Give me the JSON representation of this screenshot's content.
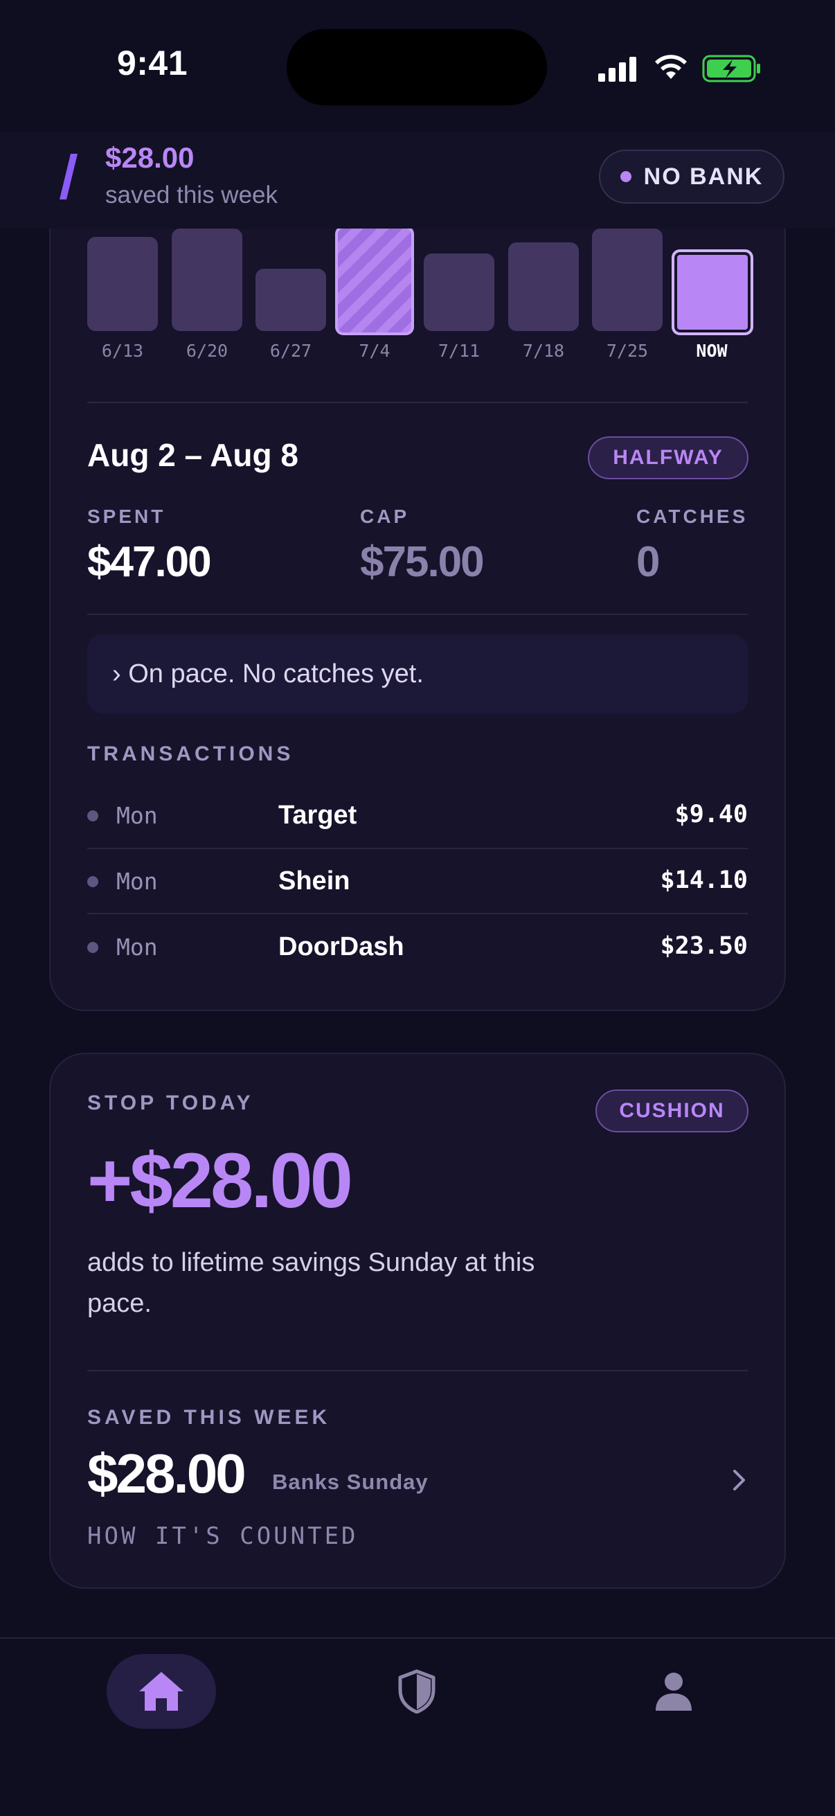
{
  "status": {
    "time": "9:41"
  },
  "header": {
    "amount": "$28.00",
    "subtitle": "saved this week",
    "bank_status": "NO BANK"
  },
  "chart": {
    "categories": [
      "6/13",
      "6/20",
      "6/27",
      "7/4",
      "7/11",
      "7/18",
      "7/25",
      "NOW"
    ],
    "highlighted": "7/4",
    "current": "NOW"
  },
  "week": {
    "range": "Aug 2 – Aug 8",
    "badge": "HALFWAY",
    "spent_label": "SPENT",
    "spent_value": "$47.00",
    "cap_label": "CAP",
    "cap_value": "$75.00",
    "catches_label": "CATCHES",
    "catches_value": "0",
    "pace_message": "› On pace. No catches yet."
  },
  "transactions": {
    "title": "TRANSACTIONS",
    "rows": [
      {
        "day": "Mon",
        "merchant": "Target",
        "amount": "$9.40"
      },
      {
        "day": "Mon",
        "merchant": "Shein",
        "amount": "$14.10"
      },
      {
        "day": "Mon",
        "merchant": "DoorDash",
        "amount": "$23.50"
      }
    ]
  },
  "stop_today": {
    "label": "STOP TODAY",
    "badge": "CUSHION",
    "amount": "+$28.00",
    "description": "adds to lifetime savings Sunday at this pace.",
    "saved_label": "SAVED THIS WEEK",
    "saved_amount": "$28.00",
    "banks_text": "Banks Sunday",
    "how_link": "HOW IT'S COUNTED"
  },
  "tabs": [
    "home",
    "shield",
    "profile"
  ],
  "colors": {
    "accent": "#b987f5",
    "background": "#0f0d20",
    "card": "#16132b"
  }
}
